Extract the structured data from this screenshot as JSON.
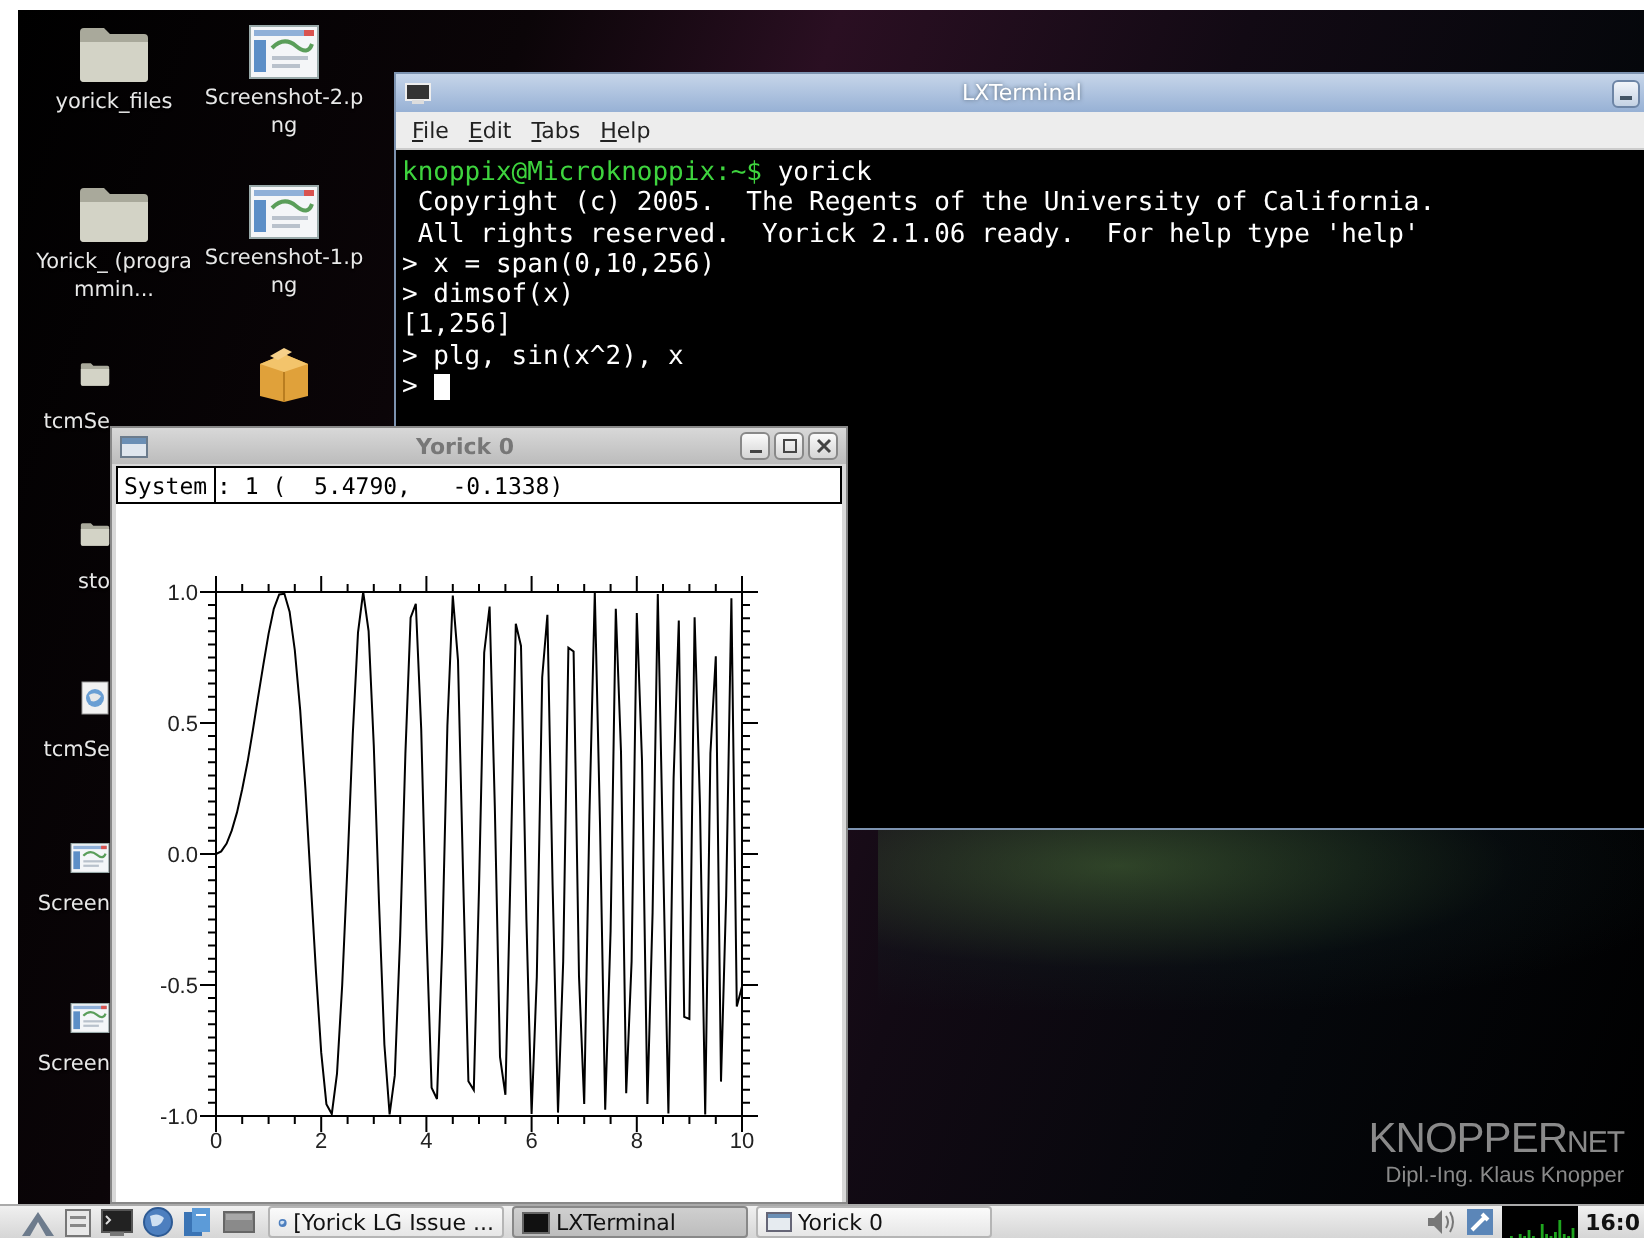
{
  "desktop": {
    "icons": [
      {
        "kind": "folder",
        "label": "yorick_files"
      },
      {
        "kind": "folder",
        "label": "Yorick_ (programmin..."
      },
      {
        "kind": "folder",
        "label": "tcmSe"
      },
      {
        "kind": "folder",
        "label": "sto"
      },
      {
        "kind": "web",
        "label": "tcmSe"
      },
      {
        "kind": "screenshot",
        "label": "Screen"
      },
      {
        "kind": "screenshot",
        "label": "Screen"
      },
      {
        "kind": "screenshot",
        "label": "Screenshot-2.png"
      },
      {
        "kind": "screenshot",
        "label": "Screenshot-1.png"
      },
      {
        "kind": "package"
      }
    ],
    "wallpaper": {
      "brand": "KNOPPER",
      "brand_suffix": "NET",
      "tagline": "Dipl.-Ing. Klaus Knopper"
    }
  },
  "terminal": {
    "title": "LXTerminal",
    "menu": [
      "File",
      "Edit",
      "Tabs",
      "Help"
    ],
    "lines": [
      {
        "prompt": "knoppix@Microknoppix:~$",
        "text": " yorick"
      },
      {
        "text": " Copyright (c) 2005.  The Regents of the University of California."
      },
      {
        "text": " All rights reserved.  Yorick 2.1.06 ready.  For help type 'help'"
      },
      {
        "text": "> x = span(0,10,256)"
      },
      {
        "text": "> dimsof(x)"
      },
      {
        "text": "[1,256]"
      },
      {
        "text": "> plg, sin(x^2), x"
      },
      {
        "text": ">",
        "cursor": true
      }
    ]
  },
  "plot_window": {
    "title": "Yorick 0",
    "system_label": "System",
    "coordinates": ": 1 (  5.4790,   -0.1338)",
    "chart_data": {
      "type": "line",
      "x": [
        0,
        0.1,
        0.2,
        0.3,
        0.4,
        0.5,
        0.6,
        0.7,
        0.8,
        0.9,
        1,
        1.1,
        1.2,
        1.3,
        1.4,
        1.5,
        1.6,
        1.7,
        1.8,
        1.9,
        2,
        2.1,
        2.2,
        2.3,
        2.4,
        2.5,
        2.6,
        2.7,
        2.8,
        2.9,
        3,
        3.1,
        3.2,
        3.3,
        3.4,
        3.5,
        3.6,
        3.7,
        3.8,
        3.9,
        4,
        4.1,
        4.2,
        4.3,
        4.4,
        4.5,
        4.6,
        4.7,
        4.8,
        4.9,
        5,
        5.1,
        5.2,
        5.3,
        5.4,
        5.5,
        5.6,
        5.7,
        5.8,
        5.9,
        6,
        6.1,
        6.2,
        6.3,
        6.4,
        6.5,
        6.6,
        6.7,
        6.8,
        6.9,
        7,
        7.1,
        7.2,
        7.3,
        7.4,
        7.5,
        7.6,
        7.7,
        7.8,
        7.9,
        8,
        8.1,
        8.2,
        8.3,
        8.4,
        8.5,
        8.6,
        8.7,
        8.8,
        8.9,
        9,
        9.1,
        9.2,
        9.3,
        9.4,
        9.5,
        9.6,
        9.7,
        9.8,
        9.9,
        10
      ],
      "series": [
        {
          "color": "#000000",
          "values": [
            0,
            0.01,
            0.04,
            0.09,
            0.159,
            0.247,
            0.352,
            0.471,
            0.597,
            0.724,
            0.841,
            0.936,
            0.991,
            0.993,
            0.925,
            0.778,
            0.549,
            0.249,
            -0.098,
            -0.452,
            -0.757,
            -0.955,
            -0.992,
            -0.838,
            -0.5,
            -0.033,
            0.459,
            0.845,
            1.0,
            0.85,
            0.412,
            -0.184,
            -0.728,
            -0.994,
            -0.845,
            -0.311,
            0.383,
            0.902,
            0.955,
            0.478,
            -0.288,
            -0.892,
            -0.935,
            -0.352,
            0.489,
            0.986,
            0.739,
            -0.099,
            -0.867,
            -0.901,
            -0.132,
            0.769,
            0.944,
            0.183,
            -0.774,
            -0.919,
            -0.056,
            0.879,
            0.794,
            -0.25,
            -0.992,
            -0.47,
            0.675,
            0.913,
            -0.119,
            -0.987,
            -0.41,
            0.788,
            0.773,
            -0.467,
            -0.954,
            0.144,
            1.0,
            0.117,
            -0.976,
            -0.294,
            0.936,
            0.39,
            -0.913,
            -0.41,
            0.92,
            0.356,
            -0.954,
            -0.223,
            0.992,
            0.007,
            -0.991,
            0.288,
            0.891,
            -0.621,
            -0.63,
            0.904,
            0.182,
            -0.995,
            0.385,
            0.755,
            -0.869,
            -0.157,
            0.976,
            -0.582,
            -0.506
          ]
        }
      ],
      "xlim": [
        0,
        10
      ],
      "ylim": [
        -1,
        1
      ],
      "xticks": [
        0,
        2,
        4,
        6,
        8,
        10
      ],
      "yticks": [
        {
          "value": -1,
          "label": "-1.0"
        },
        {
          "value": -0.5,
          "label": "-0.5"
        },
        {
          "value": 0,
          "label": "0.0"
        },
        {
          "value": 0.5,
          "label": "0.5"
        },
        {
          "value": 1,
          "label": "1.0"
        }
      ]
    }
  },
  "taskbar": {
    "tasks": [
      {
        "kind": "browser",
        "label": "[Yorick LG Issue ...",
        "selected": false
      },
      {
        "kind": "terminal",
        "label": "LXTerminal",
        "selected": true
      },
      {
        "kind": "window",
        "label": "Yorick 0",
        "selected": false
      }
    ],
    "clock": "16:0"
  }
}
